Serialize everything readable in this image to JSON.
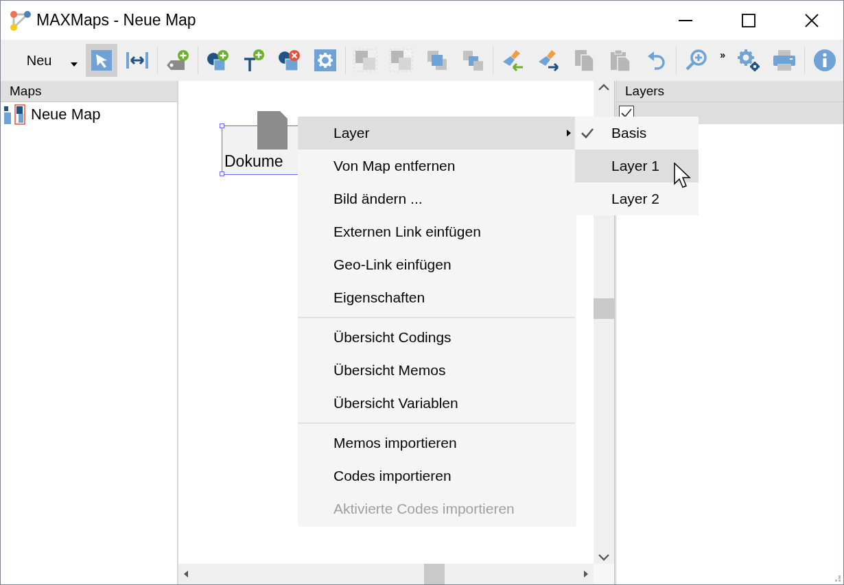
{
  "window": {
    "title": "MAXMaps - Neue Map"
  },
  "toolbar": {
    "new_button": "Neu",
    "more": "»",
    "groups": [
      [
        {
          "selected": true,
          "disabled": false
        },
        {
          "selected": false,
          "disabled": false
        }
      ],
      [
        {
          "selected": false,
          "disabled": false
        }
      ],
      [
        {
          "selected": false,
          "disabled": false
        },
        {
          "selected": false,
          "disabled": false
        },
        {
          "selected": false,
          "disabled": false
        },
        {
          "selected": false,
          "disabled": false
        }
      ],
      [
        {
          "selected": false,
          "disabled": true
        },
        {
          "selected": false,
          "disabled": true
        },
        {
          "selected": false,
          "disabled": false
        },
        {
          "selected": false,
          "disabled": false
        }
      ],
      [
        {
          "selected": false,
          "disabled": false
        },
        {
          "selected": false,
          "disabled": false
        },
        {
          "selected": false,
          "disabled": true
        },
        {
          "selected": false,
          "disabled": true
        },
        {
          "selected": false,
          "disabled": false
        }
      ],
      [
        {
          "selected": false,
          "disabled": false
        },
        {
          "selected": false,
          "disabled": false
        },
        {
          "selected": false,
          "disabled": false
        }
      ],
      [
        {
          "selected": false,
          "disabled": false
        }
      ]
    ]
  },
  "maps_panel": {
    "title": "Maps",
    "items": [
      {
        "label": "Neue Map",
        "selected": false
      }
    ]
  },
  "canvas": {
    "nodes": [
      {
        "label": "Dokume",
        "selected": true
      }
    ]
  },
  "layers_panel": {
    "title": "Layers",
    "items": [
      {
        "checked": true,
        "selected": true
      }
    ]
  },
  "context_menu": {
    "items": [
      {
        "kind": "item",
        "label": "Layer",
        "submenu": true,
        "selected": true,
        "disabled": false
      },
      {
        "kind": "item",
        "label": "Von Map entfernen",
        "submenu": false,
        "selected": false,
        "disabled": false
      },
      {
        "kind": "item",
        "label": "Bild ändern ...",
        "submenu": false,
        "selected": false,
        "disabled": false
      },
      {
        "kind": "item",
        "label": "Externen Link einfügen",
        "submenu": false,
        "selected": false,
        "disabled": false
      },
      {
        "kind": "item",
        "label": "Geo-Link einfügen",
        "submenu": false,
        "selected": false,
        "disabled": false
      },
      {
        "kind": "item",
        "label": "Eigenschaften",
        "submenu": false,
        "selected": false,
        "disabled": false
      },
      {
        "kind": "separator"
      },
      {
        "kind": "item",
        "label": "Übersicht Codings",
        "submenu": false,
        "selected": false,
        "disabled": false
      },
      {
        "kind": "item",
        "label": "Übersicht Memos",
        "submenu": false,
        "selected": false,
        "disabled": false
      },
      {
        "kind": "item",
        "label": "Übersicht Variablen",
        "submenu": false,
        "selected": false,
        "disabled": false
      },
      {
        "kind": "separator"
      },
      {
        "kind": "item",
        "label": "Memos importieren",
        "submenu": false,
        "selected": false,
        "disabled": false
      },
      {
        "kind": "item",
        "label": "Codes importieren",
        "submenu": false,
        "selected": false,
        "disabled": false
      },
      {
        "kind": "item",
        "label": "Aktivierte Codes importieren",
        "submenu": false,
        "selected": false,
        "disabled": true
      }
    ]
  },
  "submenu": {
    "items": [
      {
        "label": "Basis",
        "checked": true,
        "selected": false
      },
      {
        "label": "Layer 1",
        "checked": false,
        "selected": true
      },
      {
        "label": "Layer 2",
        "checked": false,
        "selected": false
      }
    ]
  }
}
